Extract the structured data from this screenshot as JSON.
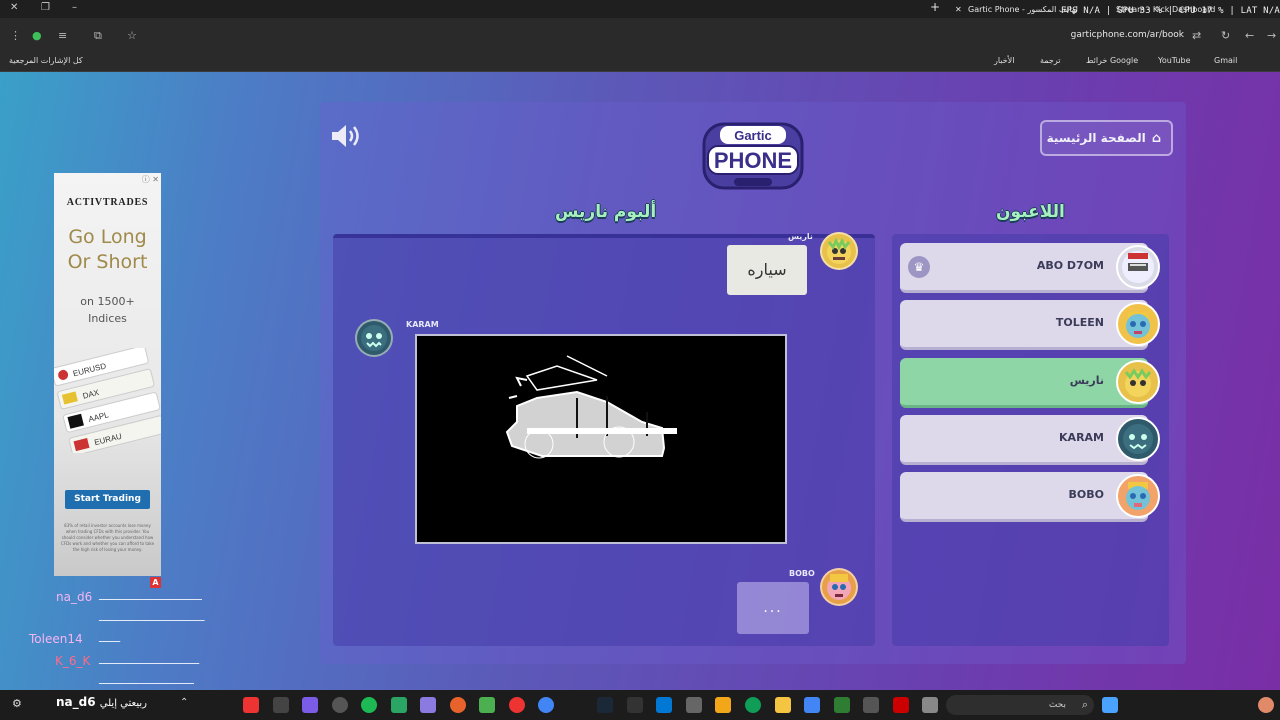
{
  "browser": {
    "tab_title": "Gartic Phone - الهاتف المكسور",
    "tab2_title": "Stream - Kick Dashboard",
    "stats": {
      "fps": "FPS N/A",
      "gpu": "GPU 33 %",
      "cpu": "CPU 17 %",
      "lat": "LAT N/A"
    },
    "url": "garticphone.com/ar/book",
    "bookmarks": [
      "Gmail",
      "YouTube",
      "خرائط Google",
      "ترجمة",
      "الأخبار"
    ],
    "all_bookmarks": "كل الإشارات المرجعية"
  },
  "game": {
    "home_label": "الصفحة الرئيسية",
    "album_title": "ألبوم ناريس",
    "players_title": "اللاعبون",
    "album": [
      {
        "author": "ناريس",
        "type": "text",
        "content": "سياره"
      },
      {
        "author": "KARAM",
        "type": "drawing",
        "content": ""
      },
      {
        "author": "BOBO",
        "type": "loading",
        "content": "..."
      }
    ],
    "players": [
      {
        "name": "ABO D7OM",
        "host": true,
        "active": false
      },
      {
        "name": "TOLEEN",
        "host": false,
        "active": false
      },
      {
        "name": "ناريس",
        "host": false,
        "active": true
      },
      {
        "name": "KARAM",
        "host": false,
        "active": false
      },
      {
        "name": "BOBO",
        "host": false,
        "active": false
      }
    ],
    "logo_top": "Gartic",
    "logo_bottom": "PHONE"
  },
  "ad": {
    "brand": "ACTIVTRADES",
    "headline_1": "Go Long",
    "headline_2": "Or Short",
    "sub_1": "on 1500+",
    "sub_2": "Indices",
    "cta": "Start Trading",
    "fine": "83% of retail investor accounts lose money when trading CFDs with this provider. You should consider whether you understand how CFDs work and whether you can afford to take the high risk of losing your money.",
    "tiles": [
      "EURUSD",
      "DAX",
      "AAPL",
      "EURAU"
    ]
  },
  "chat": [
    {
      "user": "na_d6",
      "msg": "ـــــــــــــــــــــــــــــــــــــــ"
    },
    {
      "user": "",
      "msg": "ــــــــــــــــــــــــــــــــــــــــ"
    },
    {
      "user": "Toleen14",
      "msg": "ــــــــ"
    },
    {
      "user": "K_6_K",
      "msg": "ــــــــــــــــــــــــــــــــــــــ"
    },
    {
      "user": "",
      "msg": "ــــــــــــــــــــــــــــــــــــ"
    }
  ],
  "taskbar": {
    "search": "بحث",
    "overlay_user": "na_d6",
    "overlay_msg": "ربيعتي إيلي"
  },
  "colors": {
    "active_row": "#8fd6a6",
    "accent_title": "#a7f0c0"
  }
}
